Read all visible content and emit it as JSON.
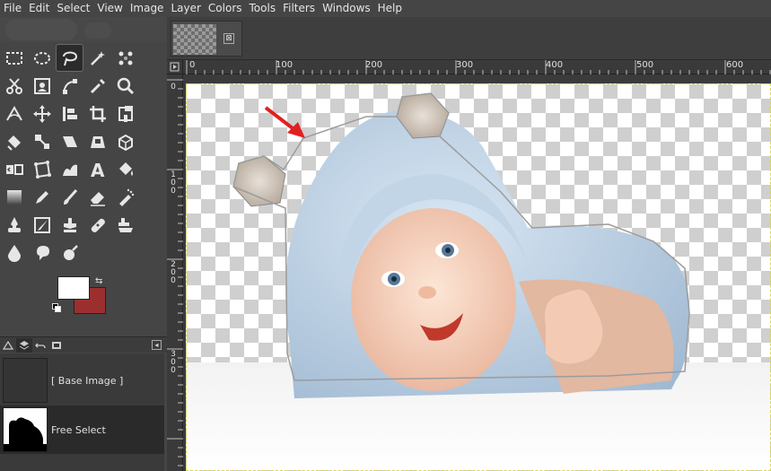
{
  "menu": [
    "File",
    "Edit",
    "Select",
    "View",
    "Image",
    "Layer",
    "Colors",
    "Tools",
    "Filters",
    "Windows",
    "Help"
  ],
  "toolbox": {
    "tools": [
      "rect-select-icon",
      "ellipse-select-icon",
      "free-select-icon",
      "fuzzy-select-icon",
      "select-by-color-icon",
      "blank",
      "scissors-select-icon",
      "foreground-select-icon",
      "paths-icon",
      "color-picker-icon",
      "zoom-icon",
      "blank",
      "measure-icon",
      "move-icon",
      "align-icon",
      "crop-icon",
      "unified-transform-icon",
      "blank",
      "rotate-icon",
      "scale-icon",
      "shear-icon",
      "perspective-icon",
      "3d-transform-icon",
      "blank",
      "flip-icon",
      "cage-transform-icon",
      "warp-transform-icon",
      "text-icon",
      "bucket-fill-icon",
      "blank",
      "gradient-icon",
      "pencil-icon",
      "paintbrush-icon",
      "eraser-icon",
      "airbrush-icon",
      "blank",
      "ink-icon",
      "mypaint-brush-icon",
      "clone-icon",
      "heal-icon",
      "perspective-clone-icon",
      "blank",
      "blur-icon",
      "smudge-icon",
      "dodge-burn-icon",
      "blank",
      "blank",
      "blank"
    ],
    "active_tool": "free-select-icon",
    "fg_color": "#ffffff",
    "bg_color": "#9b2f2f"
  },
  "layers": [
    {
      "label": "[ Base Image ]"
    },
    {
      "label": "Free Select"
    }
  ],
  "image_window": {
    "ruler_top_labels": [
      "0",
      "100",
      "200",
      "300",
      "400",
      "500",
      "600"
    ],
    "ruler_left_labels": [
      "0",
      "1\n0\n0",
      "2\n0\n0",
      "3\n0\n0"
    ],
    "close_glyph": "⊠"
  },
  "colors": {
    "ui_bg": "#454545",
    "selection_outline": "#d8d84a",
    "arrow_red": "#e02020"
  }
}
